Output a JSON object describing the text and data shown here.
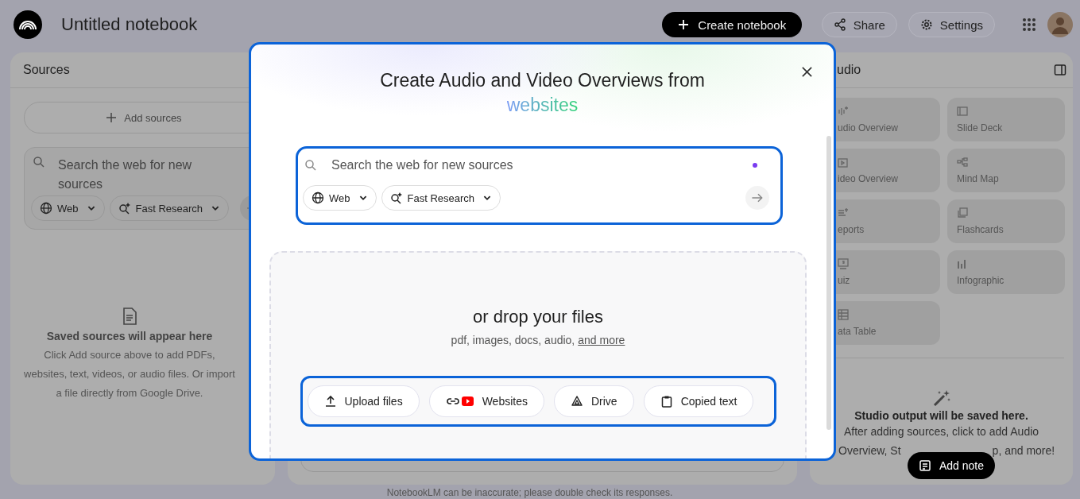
{
  "header": {
    "title": "Untitled notebook",
    "create_button": "Create notebook",
    "share_button": "Share",
    "settings_button": "Settings"
  },
  "sources": {
    "title": "Sources",
    "add_button": "Add sources",
    "search": {
      "placeholder": "Search the web for new sources",
      "chips": [
        {
          "kind": "web",
          "label": "Web"
        },
        {
          "kind": "research",
          "label": "Fast Research"
        }
      ]
    },
    "empty_title": "Saved sources will appear here",
    "empty_text": "Click Add source above to add PDFs, websites, text, videos, or audio files. Or import a file directly from Google Drive."
  },
  "chat": {
    "disclaimer": "NotebookLM can be inaccurate; please double check its responses."
  },
  "studio": {
    "title": "udio",
    "tiles": [
      {
        "kind": "audio",
        "label": "udio Overview"
      },
      {
        "kind": "slides",
        "label": "Slide Deck"
      },
      {
        "kind": "video",
        "label": "ideo Overview"
      },
      {
        "kind": "mindmap",
        "label": "Mind Map"
      },
      {
        "kind": "reports",
        "label": "eports"
      },
      {
        "kind": "flashcards",
        "label": "Flashcards"
      },
      {
        "kind": "quiz",
        "label": "uiz"
      },
      {
        "kind": "infographic",
        "label": "Infographic"
      },
      {
        "kind": "table",
        "label": "ata Table"
      }
    ],
    "empty_title": "Studio output will be saved here.",
    "empty_line": "After adding sources, click to add Audio",
    "empty_tail_left": "Overview, St",
    "empty_tail_right": "p, and more!",
    "add_note_button": "Add note"
  },
  "dialog": {
    "title": "Create Audio and Video Overviews from",
    "title_highlight": "websites",
    "search": {
      "placeholder": "Search the web for new sources",
      "chips": [
        {
          "kind": "web",
          "label": "Web"
        },
        {
          "kind": "research",
          "label": "Fast Research"
        }
      ]
    },
    "drop_title": "or drop your files",
    "drop_hint": "pdf, images, docs, audio,",
    "drop_link": "and more",
    "source_buttons": [
      {
        "kind": "upload",
        "label": "Upload files"
      },
      {
        "kind": "websites",
        "label": "Websites"
      },
      {
        "kind": "drive",
        "label": "Drive"
      },
      {
        "kind": "text",
        "label": "Copied text"
      }
    ]
  }
}
